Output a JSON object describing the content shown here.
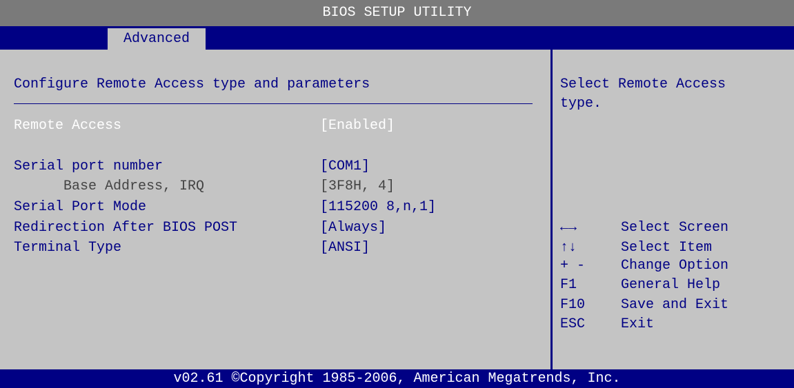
{
  "app": {
    "title": "BIOS SETUP UTILITY"
  },
  "menu": {
    "tabs": [
      {
        "label": "Advanced",
        "selected": true
      }
    ]
  },
  "main": {
    "heading": "Configure Remote Access type and parameters",
    "settings": [
      {
        "label": "Remote Access",
        "value": "[Enabled]"
      },
      {
        "label": "Serial port number",
        "value": "[COM1]"
      },
      {
        "label": "Base Address, IRQ",
        "value": "[3F8H, 4]"
      },
      {
        "label": "Serial Port Mode",
        "value": "[115200 8,n,1]"
      },
      {
        "label": "Redirection After BIOS POST",
        "value": "[Always]"
      },
      {
        "label": "Terminal Type",
        "value": "[ANSI]"
      }
    ]
  },
  "help": {
    "text_line1": "Select Remote Access",
    "text_line2": "type.",
    "keys": [
      {
        "key": "←→",
        "desc": "Select Screen"
      },
      {
        "key": "↑↓",
        "desc": "Select Item"
      },
      {
        "key": "+ -",
        "desc": "Change Option"
      },
      {
        "key": "F1",
        "desc": "General Help"
      },
      {
        "key": "F10",
        "desc": "Save and Exit"
      },
      {
        "key": "ESC",
        "desc": "Exit"
      }
    ]
  },
  "footer": {
    "text": "v02.61 ©Copyright 1985-2006, American Megatrends, Inc."
  },
  "colors": {
    "navy": "#000084",
    "panel": "#c4c4c4",
    "title_bar": "#7a7a7a"
  }
}
